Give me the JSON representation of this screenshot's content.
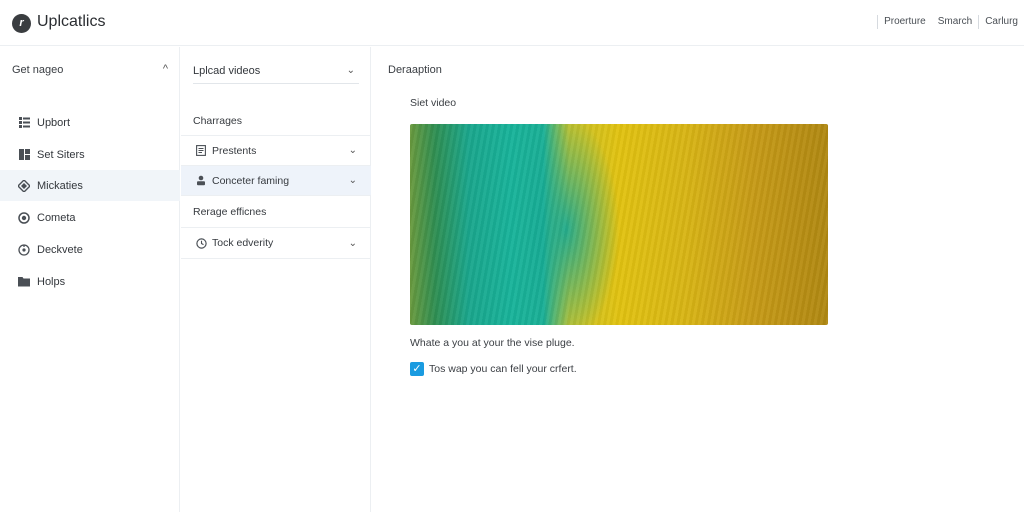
{
  "header": {
    "logo_glyph": "r",
    "title": "Uplcatlics",
    "nav": [
      "Proerture",
      "Smarch",
      "Carlurg"
    ]
  },
  "sidebar": {
    "heading": "Get nageo",
    "items": [
      {
        "label": "Upbort",
        "icon": "list-icon"
      },
      {
        "label": "Set Siters",
        "icon": "grid-icon"
      },
      {
        "label": "Mickaties",
        "icon": "diamond-icon",
        "active": true
      },
      {
        "label": "Cometa",
        "icon": "record-icon"
      },
      {
        "label": "Deckvete",
        "icon": "settings-icon"
      },
      {
        "label": "Holps",
        "icon": "folder-icon"
      }
    ]
  },
  "middle": {
    "upload_select": "Lplcad videos",
    "group1_title": "Charrages",
    "items1": [
      {
        "label": "Prestents",
        "icon": "document-icon"
      },
      {
        "label": "Conceter faming",
        "icon": "user-icon",
        "active": true
      }
    ],
    "group2_title": "Rerage efficnes",
    "items2": [
      {
        "label": "Tock edverity",
        "icon": "clock-icon"
      }
    ]
  },
  "main": {
    "title": "Deraaption",
    "video_label": "Siet video",
    "caption": "Whate a you at your the vise pluge.",
    "checkbox_label": "Tos wap you can fell your crfert.",
    "checkbox_checked": true
  },
  "colors": {
    "accent": "#1a9be0",
    "active_bg": "#eef3fa"
  }
}
